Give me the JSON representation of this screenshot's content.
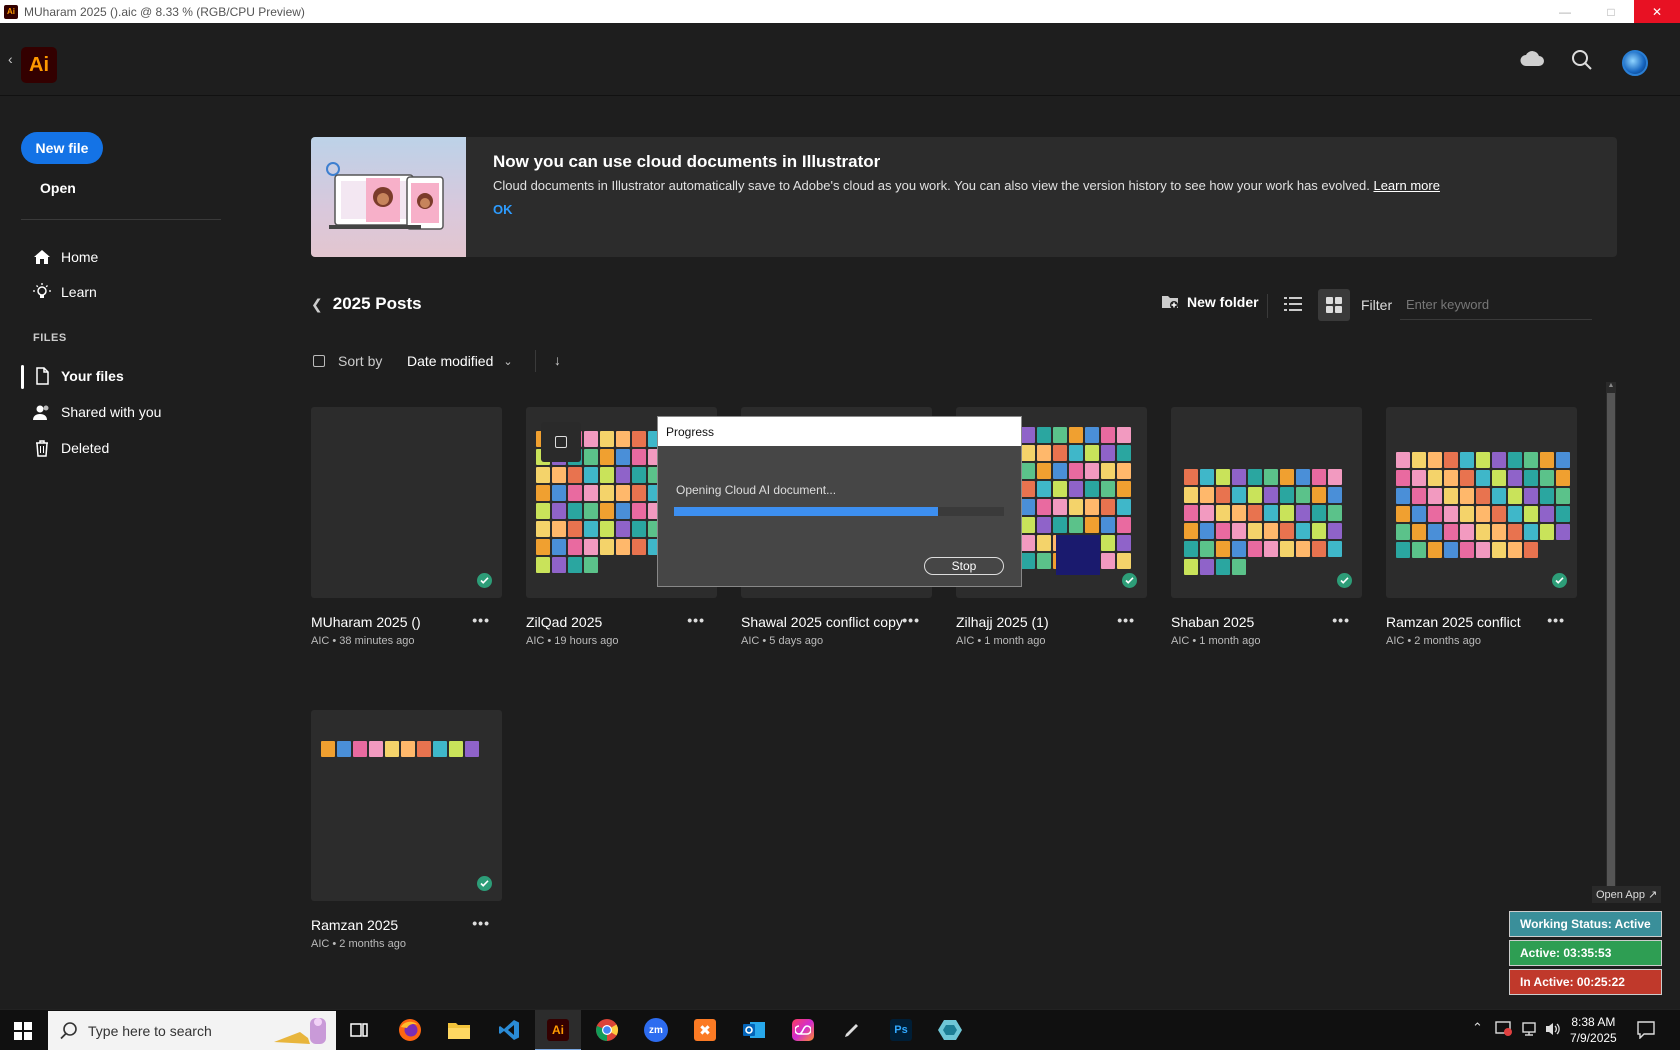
{
  "window": {
    "title": "MUharam 2025 ().aic @ 8.33 % (RGB/CPU Preview)"
  },
  "app": {
    "logo": "Ai",
    "header_icons": [
      "cloud-icon",
      "search-icon",
      "avatar"
    ]
  },
  "sidebar": {
    "new_file": "New file",
    "open": "Open",
    "nav": [
      {
        "label": "Home",
        "icon": "home-icon"
      },
      {
        "label": "Learn",
        "icon": "lightbulb-icon"
      }
    ],
    "files_header": "FILES",
    "files": [
      {
        "label": "Your files",
        "icon": "file-icon",
        "active": true
      },
      {
        "label": "Shared with you",
        "icon": "users-icon"
      },
      {
        "label": "Deleted",
        "icon": "trash-icon"
      }
    ]
  },
  "banner": {
    "title": "Now you can use cloud documents in Illustrator",
    "text": "Cloud documents in Illustrator automatically save to Adobe's cloud as you work. You can also view the version history to see how your work has evolved.",
    "learn_more": "Learn more",
    "ok": "OK"
  },
  "folder": {
    "title": "2025 Posts",
    "new_folder": "New folder",
    "filter_label": "Filter",
    "filter_placeholder": "Enter keyword",
    "sort_label": "Sort by",
    "sort_value": "Date modified"
  },
  "files": [
    {
      "name": "MUharam 2025 ()",
      "meta": "AIC • 38 minutes ago"
    },
    {
      "name": "ZilQad 2025",
      "meta": "AIC • 19 hours ago"
    },
    {
      "name": "Shawal 2025 conflict copy",
      "meta": "AIC • 5 days ago"
    },
    {
      "name": "Zilhajj 2025 (1)",
      "meta": "AIC • 1 month ago"
    },
    {
      "name": "Shaban 2025",
      "meta": "AIC • 1 month ago"
    },
    {
      "name": "Ramzan 2025 conflict",
      "meta": "AIC • 2 months ago"
    },
    {
      "name": "Ramzan 2025",
      "meta": "AIC • 2 months ago"
    }
  ],
  "progress": {
    "title": "Progress",
    "message": "Opening Cloud AI document...",
    "value": 0.8,
    "stop": "Stop"
  },
  "status": {
    "open_app": "Open App ↗",
    "working": "Working Status: Active",
    "active": "Active: 03:35:53",
    "inactive": "In Active: 00:25:22",
    "colors": {
      "working": "#3a8f9a",
      "active": "#2e9e53",
      "inactive": "#c0392b"
    }
  },
  "taskbar": {
    "search_placeholder": "Type here to search",
    "time": "8:38 AM",
    "date": "7/9/2025",
    "apps": [
      "task-view-icon",
      "firefox-icon",
      "file-explorer-icon",
      "vscode-icon",
      "illustrator-icon",
      "chrome-icon",
      "zoom-icon",
      "xampp-icon",
      "outlook-icon",
      "creative-cloud-icon",
      "pen-icon",
      "photoshop-icon",
      "app-icon"
    ]
  }
}
